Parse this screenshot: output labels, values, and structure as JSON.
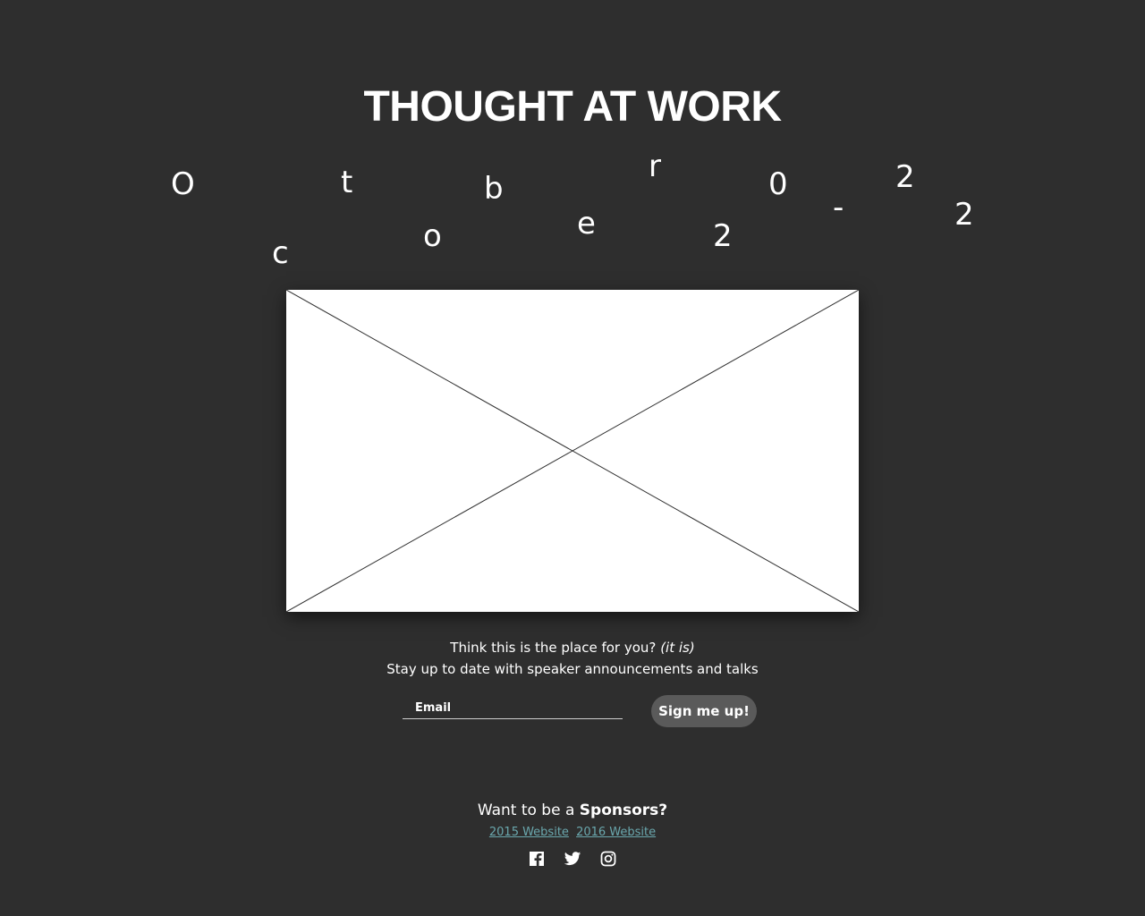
{
  "header": {
    "title": "THOUGHT AT WORK"
  },
  "date_banner": {
    "characters": [
      "O",
      "c",
      "t",
      "o",
      "b",
      "e",
      "r",
      "2",
      "0",
      "-",
      "2",
      "2"
    ]
  },
  "hero": {
    "image_alt": "image placeholder"
  },
  "signup": {
    "line1": "Think this is the place for you?",
    "line1_italic": "(it is)",
    "line2": "Stay up to date with speaker announcements and talks",
    "email_placeholder": "Email",
    "button_label": "Sign me up!"
  },
  "footer": {
    "sponsor_prefix": "Want to be a",
    "sponsor_bold": "Sponsors?",
    "links": [
      {
        "label": "2015 Website"
      },
      {
        "label": "2016 Website"
      }
    ],
    "social": [
      "facebook-icon",
      "twitter-icon",
      "instagram-icon"
    ]
  },
  "colors": {
    "background": "#2e2e2e",
    "text": "#ffffff",
    "link": "#6aa7ad",
    "button": "#5a5a5a"
  }
}
